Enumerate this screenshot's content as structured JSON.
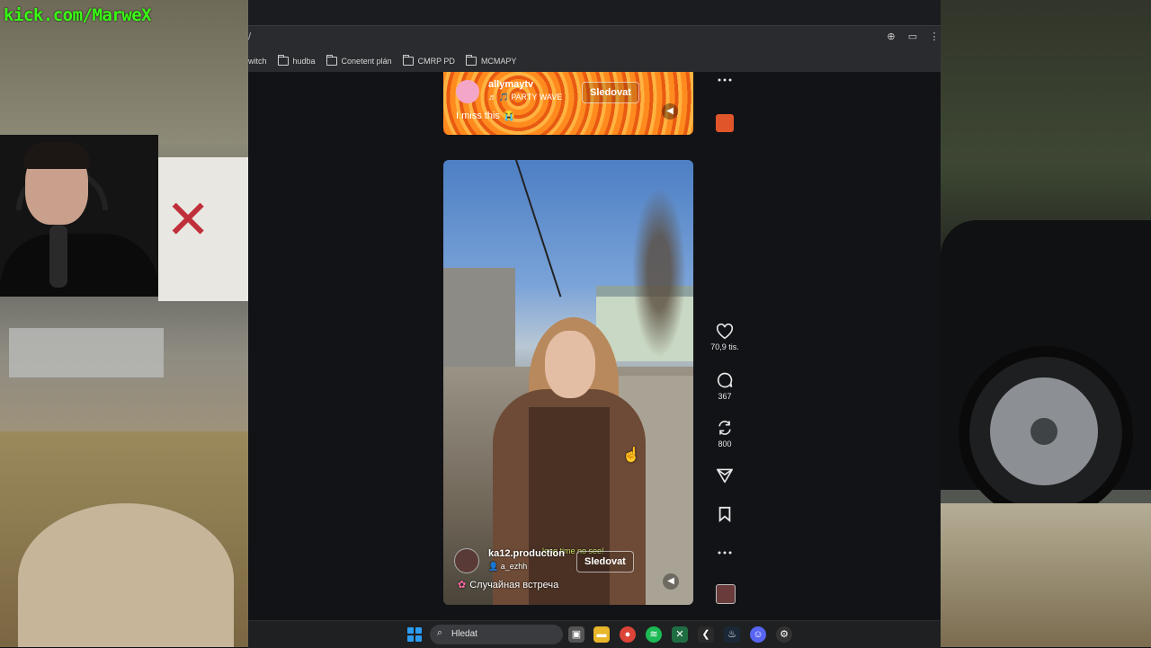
{
  "overlay": {
    "stream_link": "kick.com/MarweX"
  },
  "browser": {
    "address_fragment": "/",
    "bookmarks": [
      {
        "label": "witch"
      },
      {
        "label": "hudba"
      },
      {
        "label": "Conetent plán"
      },
      {
        "label": "CMRP PD"
      },
      {
        "label": "MCMAPY"
      }
    ]
  },
  "feed": {
    "video1": {
      "username": "allymaytv",
      "music": "♬ 🎵 PARTY WAVE",
      "follow_label": "Sledovat",
      "caption": "I miss this 😭"
    },
    "video2": {
      "username": "ka12.production",
      "sub_user": "👤 a_ezhh",
      "overlay_text": "long time no see!",
      "follow_label": "Sledovat",
      "caption": "Случайная встреча"
    },
    "rail": {
      "likes": "70,9 tis.",
      "comments": "367",
      "reposts": "800"
    }
  },
  "taskbar": {
    "search_placeholder": "Hledat"
  },
  "colors": {
    "stream_link": "#39ff14",
    "windows_blue": "#2b9cf2",
    "spotify_green": "#1db954",
    "chrome_red": "#db4437"
  }
}
